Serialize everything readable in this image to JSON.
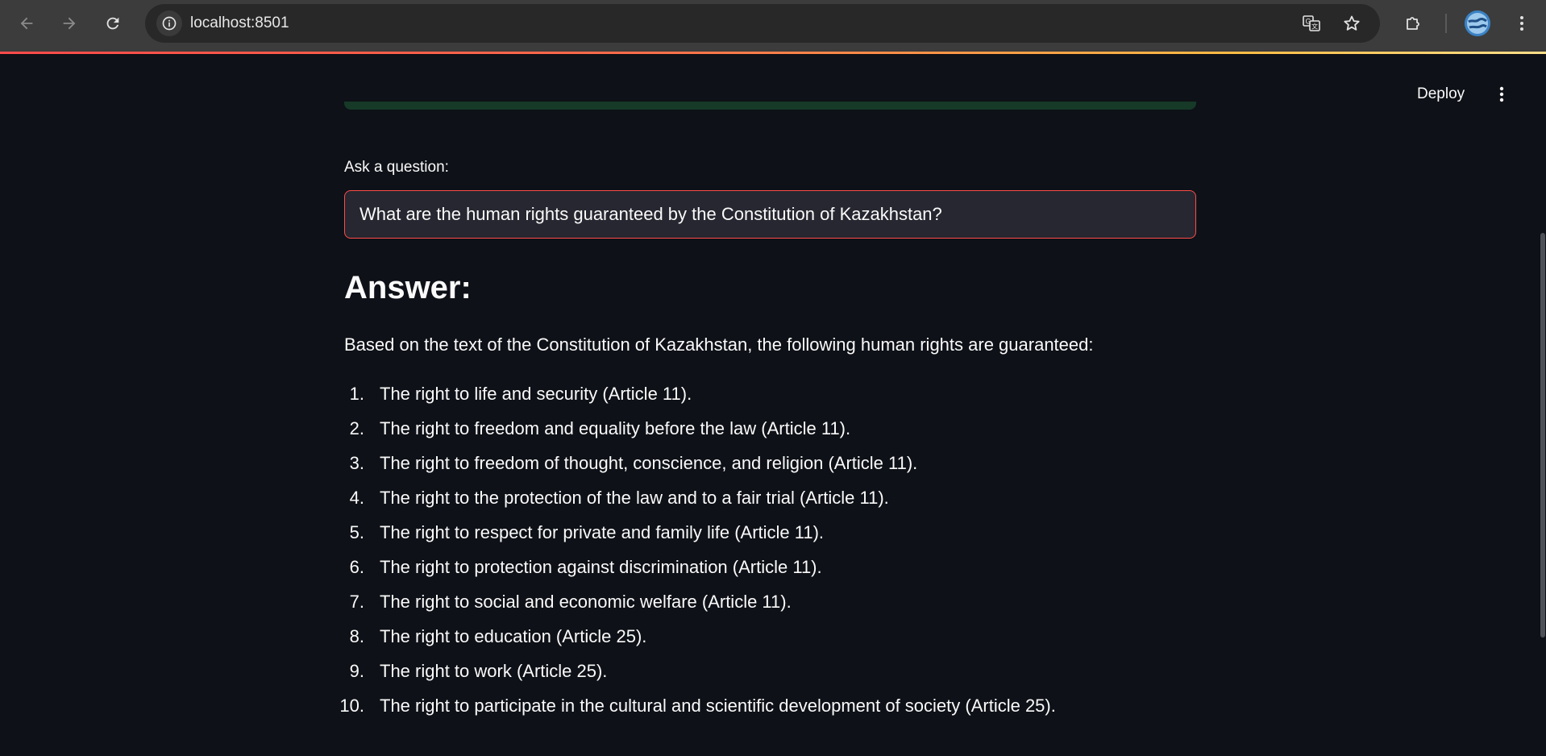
{
  "browser": {
    "url": "localhost:8501",
    "icons": {
      "back": "arrow-left-icon",
      "forward": "arrow-right-icon",
      "reload": "reload-icon",
      "site_info": "info-icon",
      "translate": "translate-icon",
      "bookmark": "star-icon",
      "extensions": "puzzle-icon",
      "profile": "avatar",
      "menu": "kebab-menu-icon"
    }
  },
  "app": {
    "deploy_label": "Deploy",
    "question_label": "Ask a question:",
    "question_value": "What are the human rights guaranteed by the Constitution of Kazakhstan?",
    "answer_heading": "Answer:",
    "answer_intro": "Based on the text of the Constitution of Kazakhstan, the following human rights are guaranteed:",
    "rights": [
      {
        "num": "1.",
        "text": "The right to life and security (Article 11)."
      },
      {
        "num": "2.",
        "text": "The right to freedom and equality before the law (Article 11)."
      },
      {
        "num": "3.",
        "text": "The right to freedom of thought, conscience, and religion (Article 11)."
      },
      {
        "num": "4.",
        "text": "The right to the protection of the law and to a fair trial (Article 11)."
      },
      {
        "num": "5.",
        "text": "The right to respect for private and family life (Article 11)."
      },
      {
        "num": "6.",
        "text": "The right to protection against discrimination (Article 11)."
      },
      {
        "num": "7.",
        "text": "The right to social and economic welfare (Article 11)."
      },
      {
        "num": "8.",
        "text": "The right to education (Article 25)."
      },
      {
        "num": "9.",
        "text": "The right to work (Article 25)."
      },
      {
        "num": "10.",
        "text": "The right to participate in the cultural and scientific development of society (Article 25)."
      }
    ]
  },
  "colors": {
    "app_background": "#0e1117",
    "input_border_focus": "#ff4b4b",
    "success_box": "#173928",
    "text": "#fafafa"
  }
}
